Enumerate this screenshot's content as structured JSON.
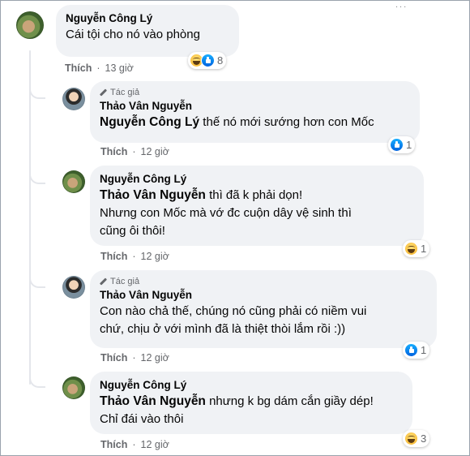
{
  "top_mark": "...",
  "comments": [
    {
      "author": "Nguyễn Công Lý",
      "text": "Cái tội cho nó vào phòng",
      "like_label": "Thích",
      "time": "13 giờ",
      "reactions": {
        "icons": [
          "haha-icon",
          "like-icon"
        ],
        "count": "8"
      }
    },
    {
      "author_badge": "Tác giả",
      "author": "Thảo Vân Nguyễn",
      "mention": "Nguyễn Công Lý",
      "text": " thế nó mới sướng hơn con Mốc",
      "like_label": "Thích",
      "time": "12 giờ",
      "reactions": {
        "icons": [
          "like-icon"
        ],
        "count": "1"
      }
    },
    {
      "author": "Nguyễn Công Lý",
      "mention": "Thảo Vân Nguyễn",
      "text_line1": " thì đã k phải dọn!",
      "text_line2": "Nhưng con Mốc mà vớ đc cuộn dây vệ sinh thì",
      "text_line3": "cũng ôi thôi!",
      "like_label": "Thích",
      "time": "12 giờ",
      "reactions": {
        "icons": [
          "haha-icon"
        ],
        "count": "1"
      }
    },
    {
      "author_badge": "Tác giả",
      "author": "Thảo Vân Nguyễn",
      "text_line1": "Con nào chả thế, chúng nó cũng phải có niềm vui",
      "text_line2": "chứ, chịu ở với mình đã là thiệt thòi lắm rồi :))",
      "like_label": "Thích",
      "time": "12 giờ",
      "reactions": {
        "icons": [
          "like-icon"
        ],
        "count": "1"
      }
    },
    {
      "author": "Nguyễn Công Lý",
      "mention": "Thảo Vân Nguyễn",
      "text_line1": " nhưng k bg dám cắn giầy dép!",
      "text_line2": "Chỉ đái vào thôi",
      "like_label": "Thích",
      "time": "12 giờ",
      "reactions": {
        "icons": [
          "haha-icon"
        ],
        "count": "3"
      }
    }
  ],
  "separator": "·"
}
